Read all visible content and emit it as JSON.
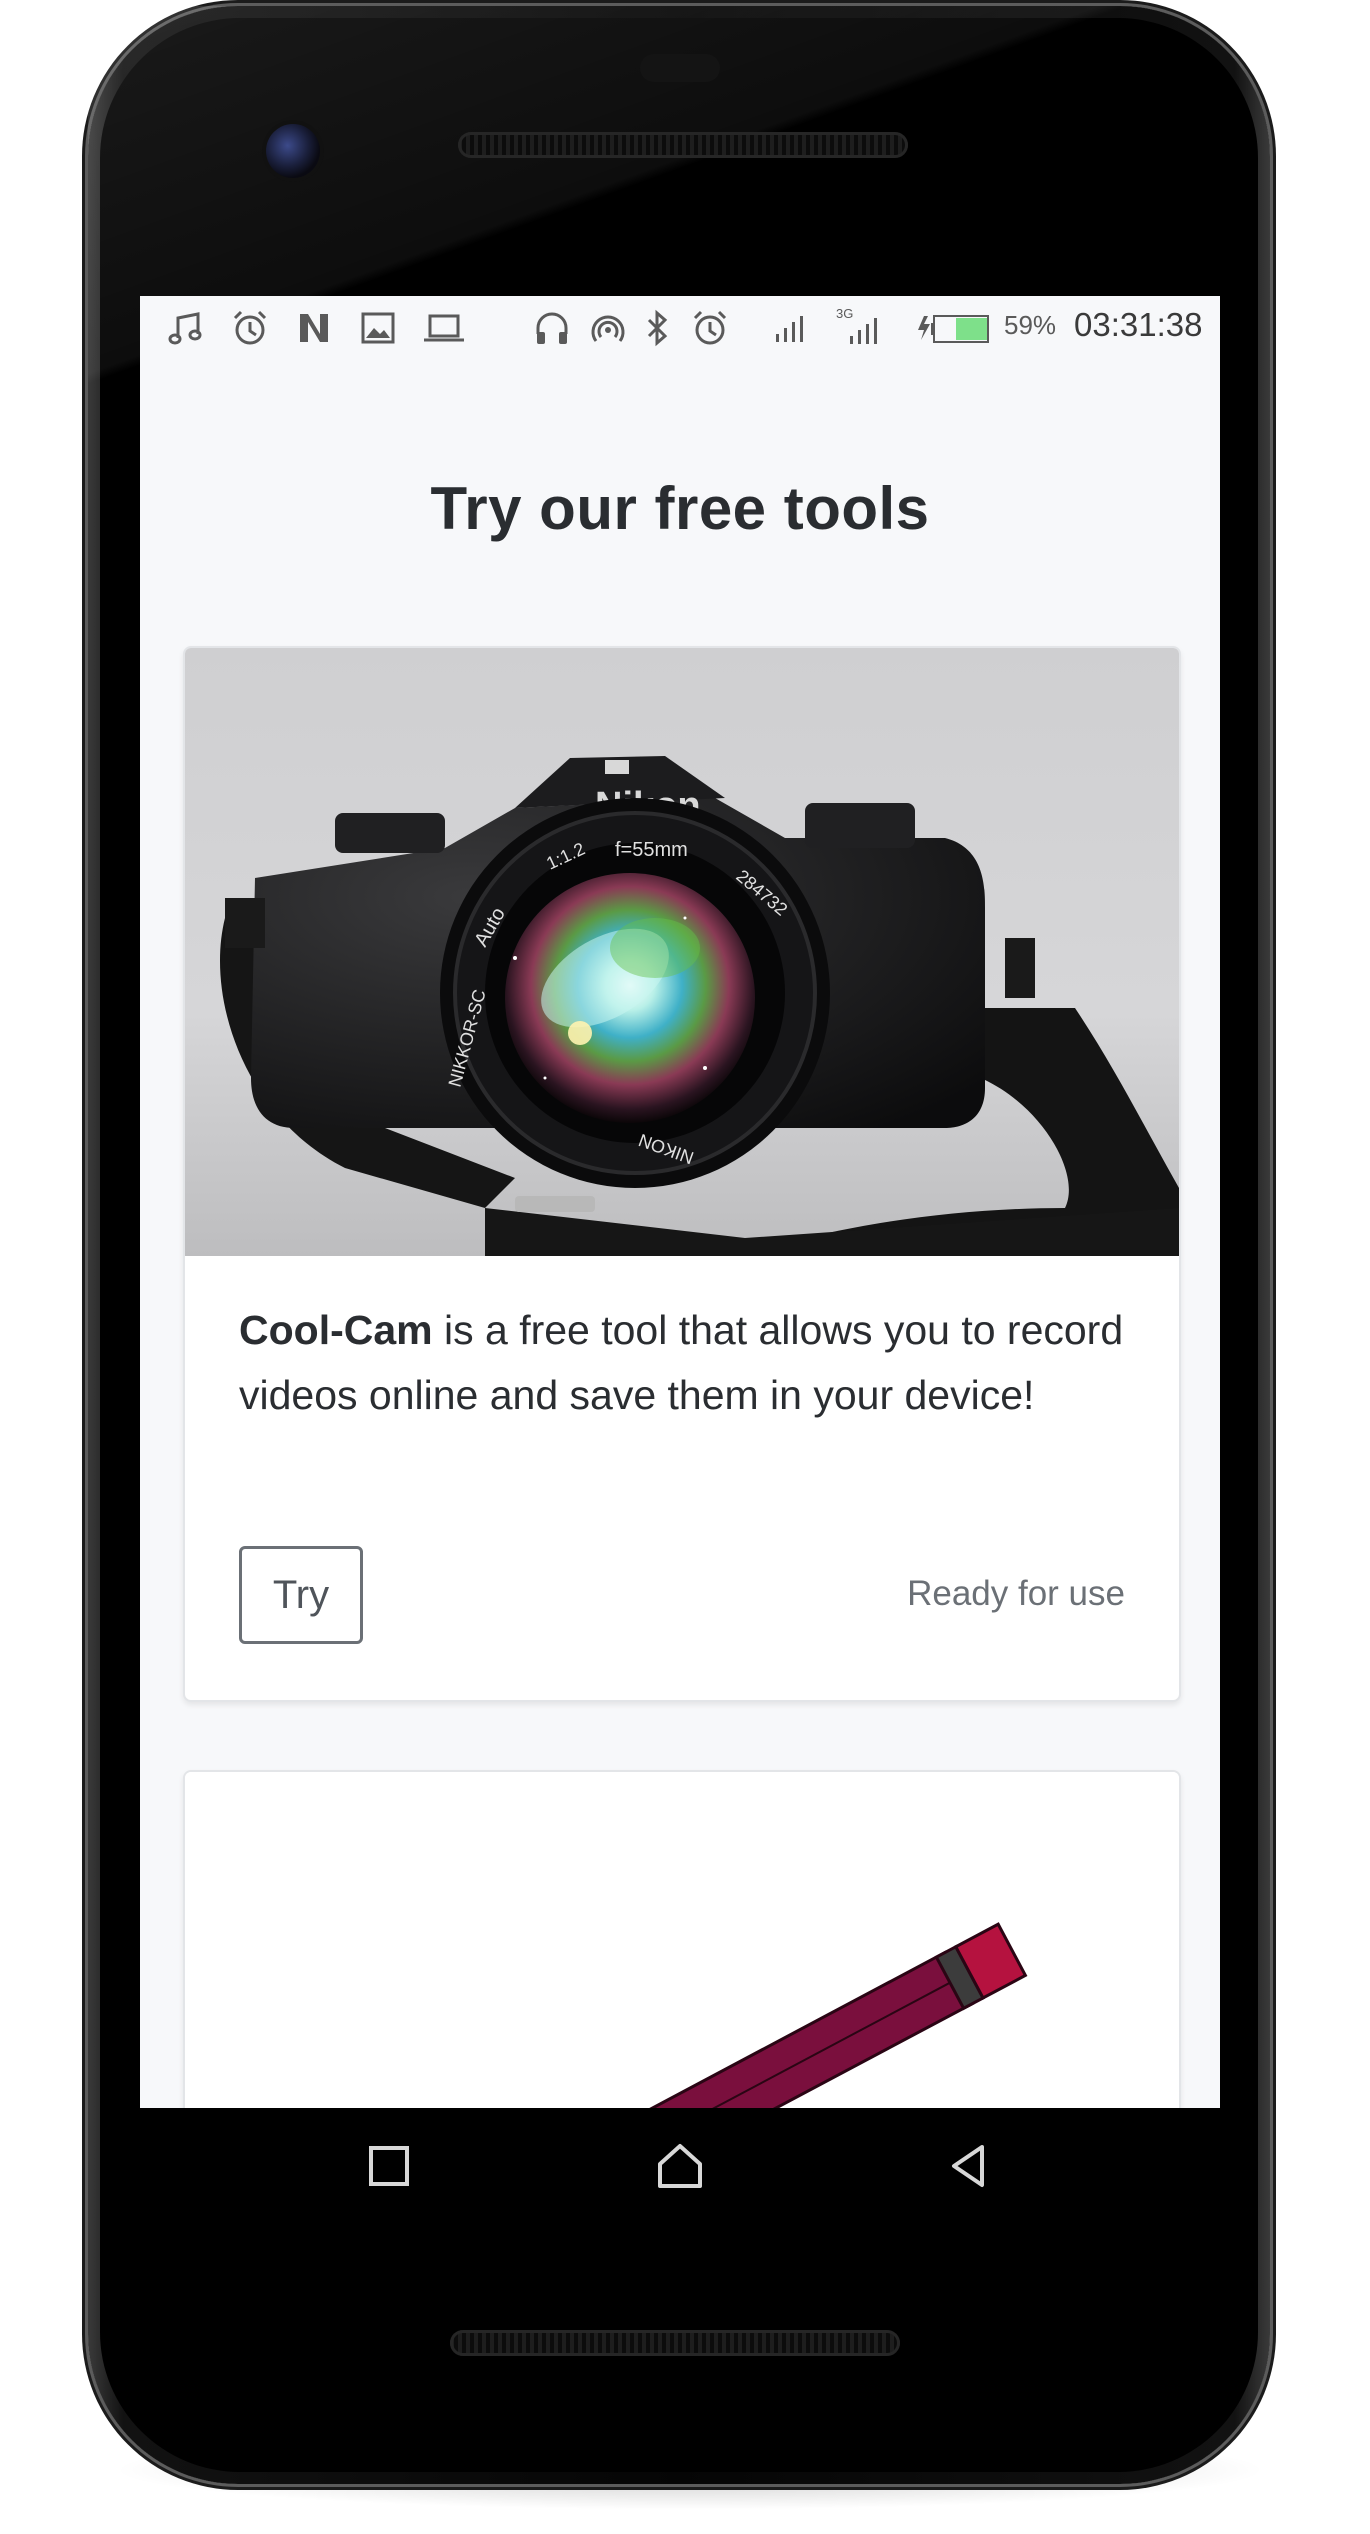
{
  "statusbar": {
    "icons": [
      "music-note-icon",
      "alarm-icon",
      "n-logo-icon",
      "image-icon",
      "laptop-icon",
      "headphones-icon",
      "hotspot-icon",
      "bluetooth-icon",
      "alarm-icon",
      "signal-icon",
      "signal-3g-icon",
      "battery-charging-icon"
    ],
    "network_label": "3G",
    "battery_percent": "59%",
    "battery_level": 0.59,
    "time": "03:31:38"
  },
  "page": {
    "title": "Try our free tools"
  },
  "cards": [
    {
      "image": "camera-galaxy-lens-image",
      "name": "Cool-Cam",
      "description": " is a free tool that allows you to record videos online and save them in your device!",
      "button_label": "Try",
      "status": "Ready for use"
    },
    {
      "image": "pencil-image"
    }
  ],
  "navbar": {
    "recents": "recents-icon",
    "home": "home-icon",
    "back": "back-icon"
  },
  "colors": {
    "screen_bg": "#f7f8fa",
    "text": "#2a2d31",
    "muted": "#6b7076",
    "battery_fill": "#7ee08a",
    "pencil": "#7a0f3d"
  }
}
